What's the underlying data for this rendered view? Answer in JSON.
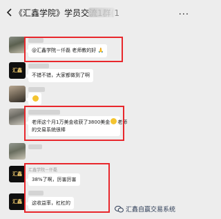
{
  "header": {
    "title": "《汇鑫学院》学员交流1群",
    "title_suffix": "(1",
    "more_icon": "more-icon"
  },
  "messages": [
    {
      "sender": "",
      "text": "@汇鑫学院－仟磊 老师教的好",
      "emoji": "🙏"
    },
    {
      "sender": "",
      "text": "不错不错，大家都做到了啊"
    },
    {
      "sender": "",
      "text": "",
      "emoji": "😄"
    },
    {
      "sender": "",
      "text_line1_a": "老师这个月1万美金收获了3800美金",
      "text_line1_b": "老师",
      "text_line2": "的交易系统很棒"
    },
    {
      "sender": "汇鑫学院－仟磊",
      "text": "38%了啊，厉害厉害"
    },
    {
      "sender": "",
      "text": "这收益率，杠杠的"
    }
  ],
  "avatars": {
    "logo_text": "汇鑫"
  },
  "watermark": {
    "text": "汇鑫自赢交易系统"
  },
  "colors": {
    "background": "#ededed",
    "bubble": "#ffffff",
    "highlight": "#e8262b",
    "emoji": "#f4c430"
  }
}
